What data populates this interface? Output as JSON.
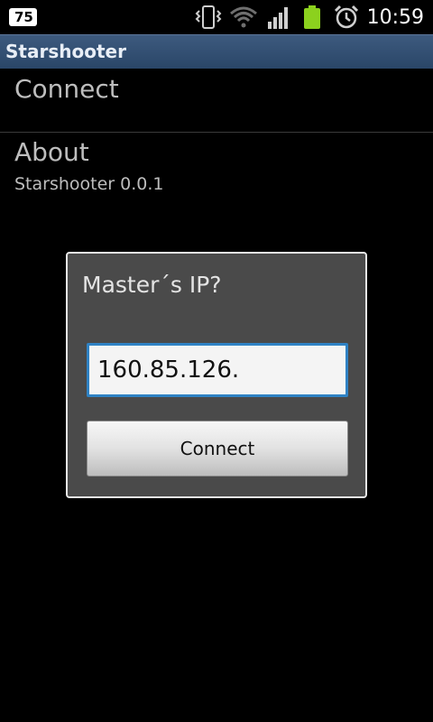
{
  "status_bar": {
    "notification_count": "75",
    "time": "10:59",
    "icons": [
      "vibrate-icon",
      "wifi-icon",
      "signal-icon",
      "battery-icon",
      "alarm-icon"
    ],
    "battery_color": "#8cd11e"
  },
  "app": {
    "title": "Starshooter"
  },
  "preferences": [
    {
      "title": "Connect",
      "summary": ""
    },
    {
      "title": "About",
      "summary": "Starshooter 0.0.1"
    }
  ],
  "dialog": {
    "title": "Master´s IP?",
    "input_value": "160.85.126.",
    "button_label": "Connect"
  },
  "colors": {
    "titlebar": "#2f4c70",
    "dialog_background": "#4a4a4a",
    "input_focus": "#2f82c4"
  }
}
